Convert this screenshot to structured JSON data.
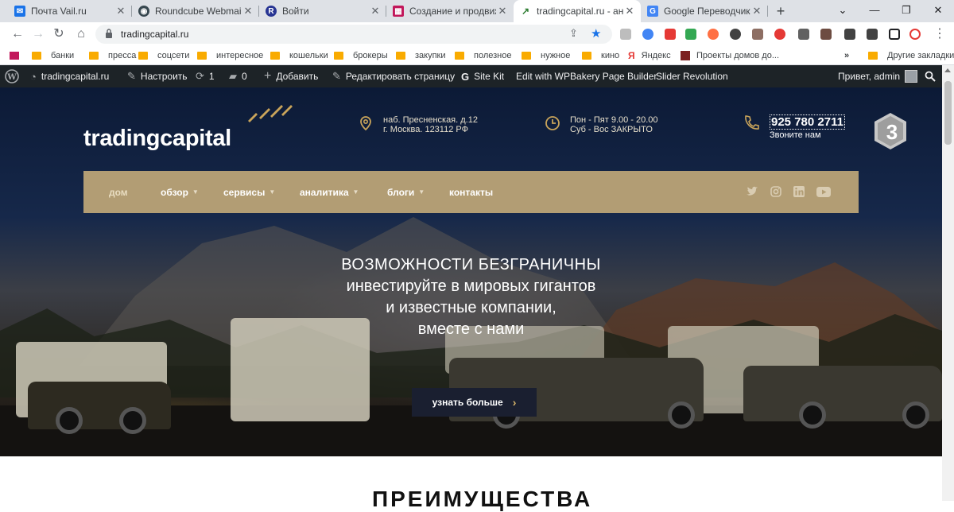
{
  "browser": {
    "tabs": [
      {
        "title": "Почта Vail.ru",
        "color": "#1a73e8",
        "glyph": "✉"
      },
      {
        "title": "Roundcube Webmail ::",
        "color": "#37474f",
        "glyph": "◉"
      },
      {
        "title": "Войти",
        "color": "#283593",
        "glyph": "R"
      },
      {
        "title": "Создание и продвиж",
        "color": "#c2185b",
        "glyph": "▦"
      },
      {
        "title": "tradingcapital.ru - ана",
        "color": "#2e7d32",
        "glyph": "↗"
      },
      {
        "title": "Google Переводчик",
        "color": "#4285f4",
        "glyph": "G"
      }
    ],
    "active_tab_index": 4,
    "url": "tradingcapital.ru",
    "bookmarks": [
      "банки",
      "пресса",
      "соцсети",
      "интересное",
      "кошельки",
      "брокеры",
      "закупки",
      "полезное",
      "нужное",
      "кино",
      "Яндекс",
      "Проекты домов до...",
      "Другие закладки"
    ],
    "more_bookmarks": "»"
  },
  "wp_admin_bar": {
    "site_name": "tradingcapital.ru",
    "customize": "Настроить",
    "updates_count": "1",
    "comments_count": "0",
    "add_new": "Добавить",
    "edit_page": "Редактировать страницу",
    "site_kit": "Site Kit",
    "wpbakery": "Edit with WPBakery Page Builder",
    "slider_revolution": "Slider Revolution",
    "greeting": "Привет, admin"
  },
  "site": {
    "logo": "tradingcapital",
    "address_line1": "наб. Пресненская. д.12",
    "address_line2": "г. Москва. 123112 РФ",
    "hours_line1": "Пон - Пят 9.00 - 20.00",
    "hours_line2": "Суб - Вос ЗАКРЫТО",
    "phone": "925 780 2711",
    "phone_sub": "Звоните нам",
    "badge_number": "3",
    "accent_color": "#b29d74",
    "menu": [
      {
        "label": "дом",
        "dropdown": false
      },
      {
        "label": "обзор",
        "dropdown": true
      },
      {
        "label": "сервисы",
        "dropdown": true
      },
      {
        "label": "аналитика",
        "dropdown": true
      },
      {
        "label": "блоги",
        "dropdown": true
      },
      {
        "label": "контакты",
        "dropdown": false
      }
    ],
    "social": [
      "twitter-icon",
      "instagram-icon",
      "linkedin-icon",
      "youtube-icon"
    ],
    "hero": {
      "line1": "ВОЗМОЖНОСТИ БЕЗГРАНИЧНЫ",
      "line2": "инвестируйте в мировых гигантов",
      "line3": "и известные компании,",
      "line4": "вместе с нами",
      "cta": "узнать больше"
    },
    "next_section_title": "ПРЕИМУЩЕСТВА"
  }
}
